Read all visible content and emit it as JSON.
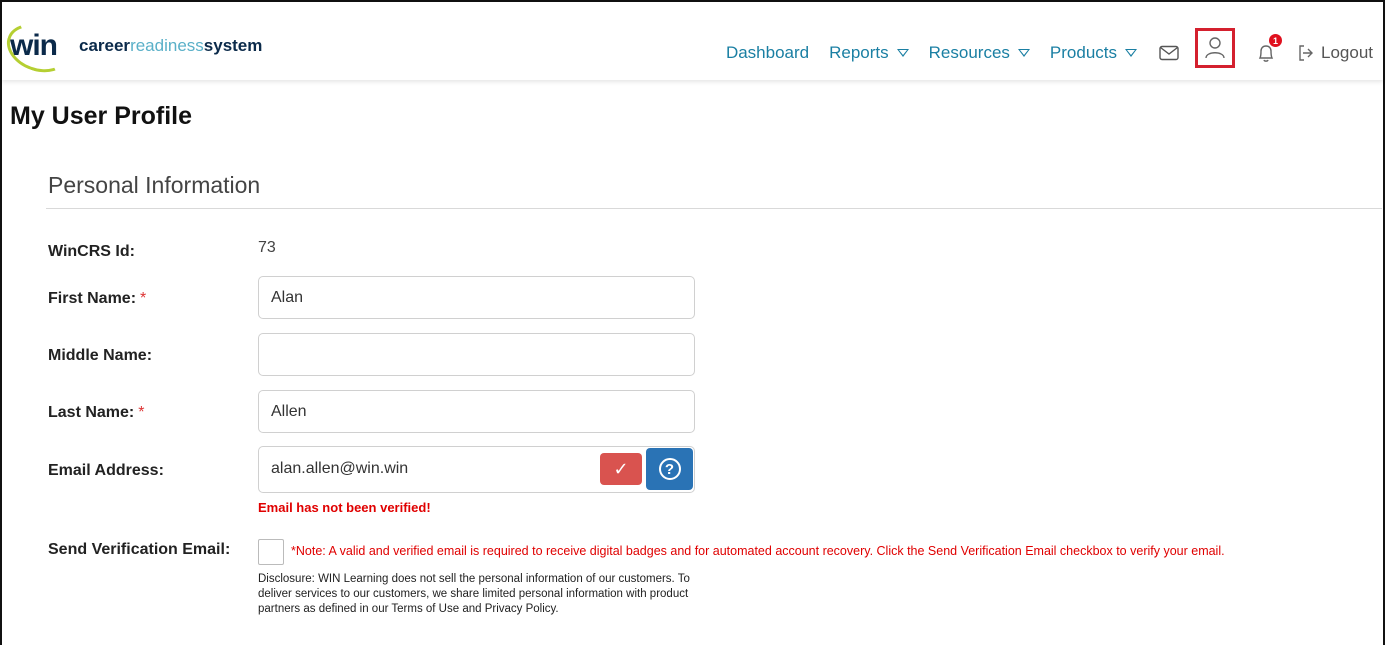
{
  "brand": {
    "logo_mark": "win",
    "name_part1": "career",
    "name_part2": "readiness",
    "name_part3": "system",
    "colors": {
      "navy": "#0b2a4a",
      "light_blue": "#5ab0c8",
      "green": "#b5cf32"
    }
  },
  "nav": {
    "dashboard": "Dashboard",
    "reports": "Reports",
    "resources": "Resources",
    "products": "Products",
    "logout": "Logout",
    "notification_count": "1",
    "icons": [
      "envelope-icon",
      "user-icon",
      "bell-icon",
      "logout-icon"
    ],
    "link_color": "#1a7fa3",
    "highlight_color": "#d4202e"
  },
  "page": {
    "title": "My User Profile",
    "section_title": "Personal Information"
  },
  "form": {
    "wincrs_id_label": "WinCRS Id:",
    "wincrs_id_value": "73",
    "first_name_label": "First Name:",
    "first_name_value": "Alan",
    "middle_name_label": "Middle Name:",
    "middle_name_value": "",
    "last_name_label": "Last Name:",
    "last_name_value": "Allen",
    "required_mark": "*",
    "email_label": "Email Address:",
    "email_value": "alan.allen@win.win",
    "verify_check_glyph": "✓",
    "help_glyph": "?",
    "email_warning": "Email has not been verified!",
    "send_verification_label": "Send Verification Email:",
    "note": "*Note: A valid and verified email is required to receive digital badges and for automated account recovery. Click the Send Verification Email checkbox to verify your email.",
    "disclosure": "Disclosure: WIN Learning does not sell the personal information of our customers. To deliver services to our customers, we share limited personal information with product partners as defined in our Terms of Use and Privacy Policy."
  }
}
